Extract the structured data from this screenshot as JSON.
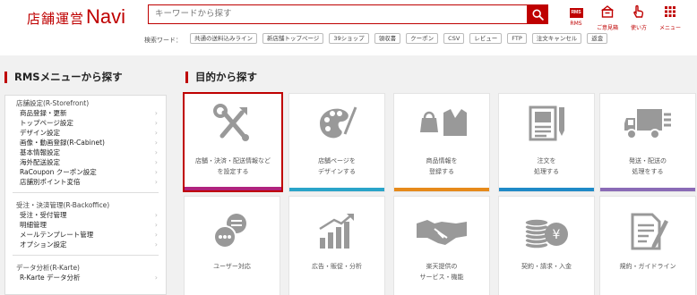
{
  "header": {
    "logo_jp": "店舗運営",
    "logo_en": "Navi",
    "search_placeholder": "キーワードから探す",
    "keyword_label": "検索ワード：",
    "keywords": [
      "共通の送料込みライン",
      "新店舗トップページ",
      "39ショップ",
      "領収書",
      "クーポン",
      "CSV",
      "レビュー",
      "FTP",
      "注文キャンセル",
      "返金"
    ],
    "icons": [
      {
        "name": "rms",
        "label": "RMS",
        "box_text": "RMS"
      },
      {
        "name": "favorites",
        "label": "ご意見箱"
      },
      {
        "name": "howto",
        "label": "使い方"
      },
      {
        "name": "menu",
        "label": "メニュー"
      }
    ]
  },
  "left": {
    "title": "RMSメニューから探す",
    "groups": [
      {
        "heading": "店舗設定(R-Storefront)",
        "items": [
          "商品登録・更新",
          "トップページ設定",
          "デザイン設定",
          "画像・動画登録(R-Cabinet)",
          "基本情報設定",
          "海外配送設定",
          "RaCoupon クーポン設定",
          "店舗別ポイント変倍"
        ]
      },
      {
        "heading": "受注・決済管理(R-Backoffice)",
        "items": [
          "受注・受付管理",
          "明細管理",
          "メールテンプレート管理",
          "オプション設定"
        ]
      },
      {
        "heading": "データ分析(R-Karte)",
        "items": [
          "R-Karte  データ分析"
        ]
      }
    ]
  },
  "right": {
    "title": "目的から探す",
    "tiles": [
      {
        "name": "store-settings",
        "lines": [
          "店舗・決済・配送情報など",
          "を設定する"
        ],
        "icon": "tools-icon",
        "color": "#b0237e"
      },
      {
        "name": "design-pages",
        "lines": [
          "店舗ページを",
          "デザインする"
        ],
        "icon": "palette-icon",
        "color": "#2aa4c9"
      },
      {
        "name": "register-products",
        "lines": [
          "商品情報を",
          "登録する"
        ],
        "icon": "product-icon",
        "color": "#e68a1b"
      },
      {
        "name": "process-orders",
        "lines": [
          "注文を",
          "処理する"
        ],
        "icon": "clipboard-icon",
        "color": "#1f8ac7"
      },
      {
        "name": "shipping",
        "lines": [
          "発送・配送の",
          "処理をする"
        ],
        "icon": "truck-icon",
        "color": "#8a6bb6"
      },
      {
        "name": "user-support",
        "lines": [
          "ユーザー対応"
        ],
        "icon": "chat-icon",
        "color": "#43a047"
      },
      {
        "name": "marketing",
        "lines": [
          "広告・販促・分析"
        ],
        "icon": "chart-icon",
        "color": "#e6b800"
      },
      {
        "name": "rakuten-services",
        "lines": [
          "楽天提供の",
          "サービス・機能"
        ],
        "icon": "handshake-icon",
        "color": "#2aa4c9"
      },
      {
        "name": "billing",
        "lines": [
          "契約・請求・入金"
        ],
        "icon": "coins-icon",
        "color": "#7cb342"
      },
      {
        "name": "guidelines",
        "lines": [
          "規約・ガイドライン"
        ],
        "icon": "document-icon",
        "color": "#e68a1b"
      }
    ]
  }
}
